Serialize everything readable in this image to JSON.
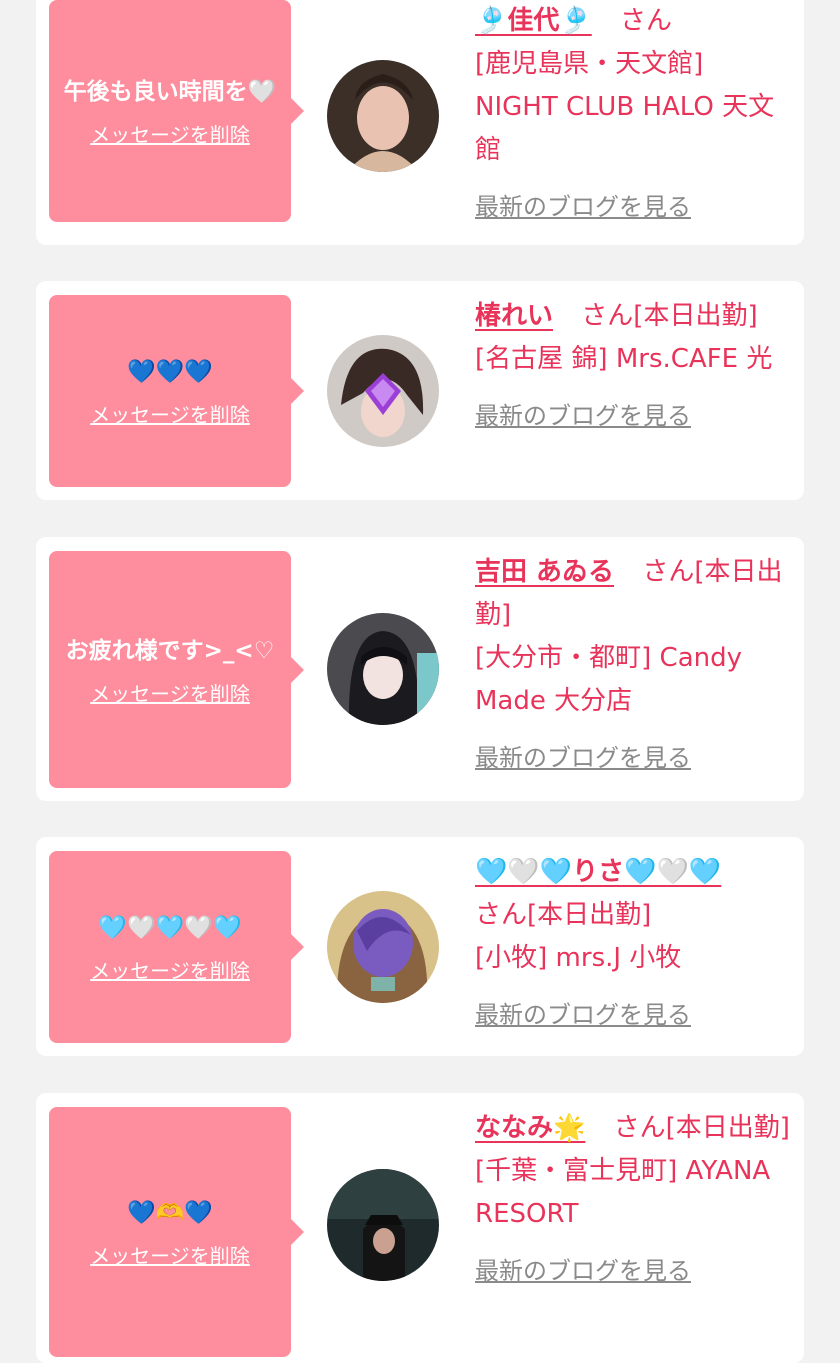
{
  "colors": {
    "bubble": "#fe8d9d",
    "accent": "#e8335a",
    "link_gray": "#8a8a8a",
    "background": "#f2f2f2"
  },
  "delete_label": "メッセージを削除",
  "blog_label": "最新のブログを見る",
  "san_label": "さん",
  "cards": [
    {
      "message": "午後も良い時間を🤍",
      "name": "🎐佳代🎐",
      "status": "",
      "shop": "[鹿児島県・天文館] NIGHT CLUB HALO 天文館",
      "avatar_icon": "avatar-photo"
    },
    {
      "message": "💙💙💙",
      "name": "椿れい",
      "status": "[本日出勤]",
      "shop": "[名古屋 錦] Mrs.CAFE 光",
      "avatar_icon": "avatar-photo"
    },
    {
      "message": "お疲れ様です>_<♡",
      "name": "吉田 あゐる",
      "status": "[本日出勤]",
      "shop": "[大分市・都町] Candy Made 大分店",
      "avatar_icon": "avatar-photo"
    },
    {
      "message": "🩵🤍🩵🤍🩵",
      "name": "🩵🤍🩵りさ🩵🤍🩵",
      "status": "[本日出勤]",
      "shop": "[小牧] mrs.J 小牧",
      "avatar_icon": "avatar-photo"
    },
    {
      "message": "💙🫶💙",
      "name": "ななみ🌟",
      "status": "[本日出勤]",
      "shop": "[千葉・富士見町] AYANA RESORT",
      "avatar_icon": "avatar-photo"
    }
  ]
}
